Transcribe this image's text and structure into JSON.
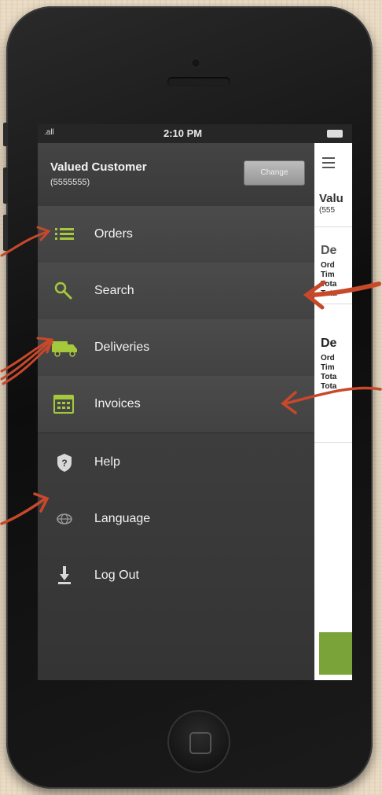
{
  "status_bar": {
    "time": "2:10 PM",
    "signal": ".all"
  },
  "user": {
    "name": "Valued Customer",
    "id": "(5555555)",
    "change_label": "Change"
  },
  "menu": {
    "primary_items": [
      {
        "label": "Orders",
        "icon": "list-icon"
      },
      {
        "label": "Search",
        "icon": "magnifier-icon"
      },
      {
        "label": "Deliveries",
        "icon": "truck-icon"
      },
      {
        "label": "Invoices",
        "icon": "calendar-icon"
      }
    ],
    "secondary_items": [
      {
        "label": "Help",
        "icon": "help-icon"
      },
      {
        "label": "Language",
        "icon": "globe-icon"
      },
      {
        "label": "Log Out",
        "icon": "logout-icon"
      }
    ]
  },
  "content_peek": {
    "title": "Valu",
    "subtitle": "(555",
    "section_1": {
      "heading": "De",
      "rows": [
        "Ord",
        "Tim",
        "Tota",
        "Tota"
      ]
    },
    "section_2": {
      "heading": "De",
      "rows": [
        "Ord",
        "Tim",
        "Tota",
        "Tota"
      ]
    }
  },
  "colors": {
    "accent_green": "#a6c83c",
    "annotation_red": "#c8482a",
    "menu_bg": "#3d3d3d"
  }
}
